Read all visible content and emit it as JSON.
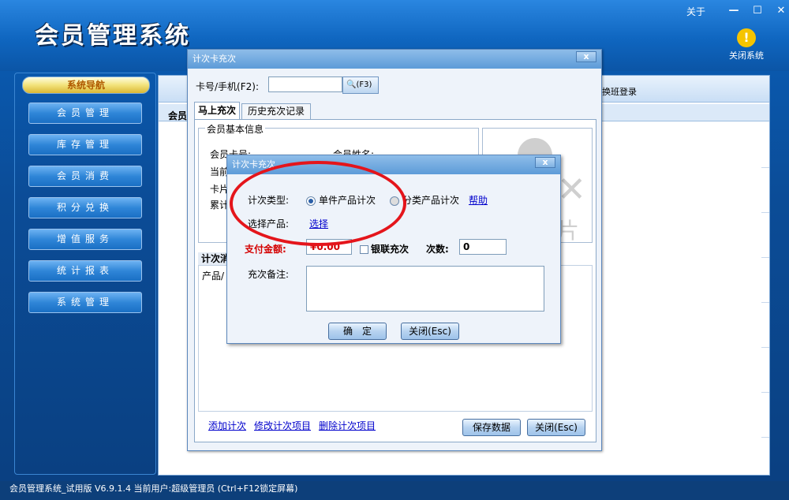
{
  "app": {
    "title": "会员管理系统",
    "about": "关于",
    "minimize": "—",
    "maximize": "☐",
    "close": "✕",
    "close_system_label": "关闭系统"
  },
  "nav": {
    "header": "系统导航",
    "items": [
      {
        "label": "会员管理"
      },
      {
        "label": "库存管理"
      },
      {
        "label": "会员消费"
      },
      {
        "label": "积分兑换"
      },
      {
        "label": "增值服务"
      },
      {
        "label": "统计报表"
      },
      {
        "label": "系统管理"
      }
    ]
  },
  "content": {
    "tab_label": "会员",
    "switch_login": "换班登录"
  },
  "status": {
    "text": "会员管理系统_试用版 V6.9.1.4 当前用户:超级管理员 (Ctrl+F12锁定屏幕)"
  },
  "dialog1": {
    "title": "计次卡充次",
    "close": "x",
    "card_label": "卡号/手机(F2):",
    "card_value": "",
    "search_label": "(F3)",
    "tabs": [
      "马上充次",
      "历史充次记录"
    ],
    "group_title": "会员基本信息",
    "fields": {
      "card_no": "会员卡号:",
      "member_name": "会员姓名:",
      "current": "当前",
      "card": "卡片",
      "total": "累计"
    },
    "photo_text": "片",
    "sub_tab": "计次消",
    "sub_header": "产品/",
    "links": [
      "添加计次",
      "修改计次项目",
      "删除计次项目"
    ],
    "save_button": "保存数据",
    "close_button": "关闭(Esc)"
  },
  "dialog2": {
    "title": "计次卡充次",
    "close": "x",
    "type_label": "计次类型:",
    "option_single": "单件产品计次",
    "option_category": "分类产品计次",
    "help": "帮助",
    "select_label": "选择产品:",
    "select_link": "选择",
    "pay_label": "支付金额:",
    "pay_value": "¥0.00",
    "unionpay_label": "银联充次",
    "count_label": "次数:",
    "count_value": "0",
    "note_label": "充次备注:",
    "note_value": "",
    "ok_button": "确　定",
    "close_button": "关闭(Esc)"
  },
  "colors": {
    "annotation_ring": "#e4151b",
    "title_bar": "#5d9bd8",
    "pay_label": "#d40000"
  }
}
